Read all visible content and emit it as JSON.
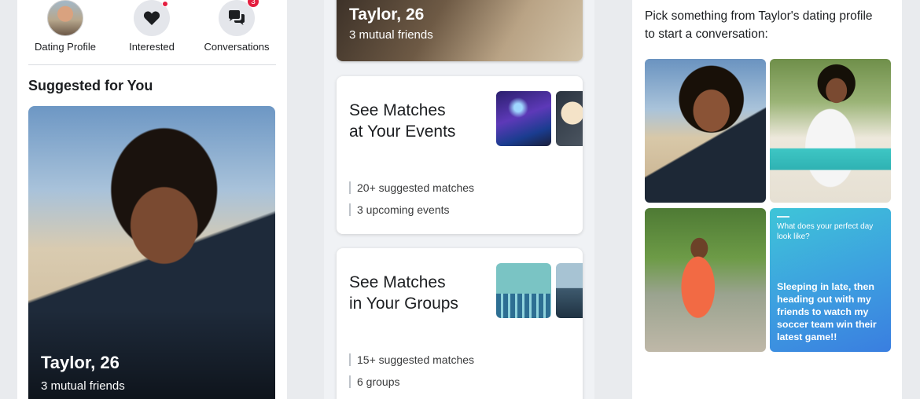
{
  "panel1": {
    "nav": [
      {
        "label": "Dating Profile"
      },
      {
        "label": "Interested"
      },
      {
        "label": "Conversations",
        "badge": "3"
      }
    ],
    "section_title": "Suggested for You",
    "profile": {
      "name": "Taylor, 26",
      "subtitle": "3 mutual friends"
    }
  },
  "panel2": {
    "top_card": {
      "name": "Taylor, 26",
      "subtitle": "3 mutual friends"
    },
    "events": {
      "title_line1": "See Matches",
      "title_line2": "at Your Events",
      "stat1": "20+ suggested matches",
      "stat2": "3 upcoming events"
    },
    "groups": {
      "title_line1": "See Matches",
      "title_line2": "in Your Groups",
      "stat1": "15+ suggested matches",
      "stat2": "6 groups"
    }
  },
  "panel3": {
    "prompt": "Pick something from Taylor's dating profile to start a conversation:",
    "question_card": {
      "question": "What does your perfect day look like?",
      "answer": "Sleeping in late, then heading out with my friends to watch my soccer team win their latest game!!"
    }
  },
  "colors": {
    "badge": "#e41e3f",
    "accent_gradient_start": "#3ec5d8",
    "accent_gradient_end": "#3a7ee0"
  }
}
